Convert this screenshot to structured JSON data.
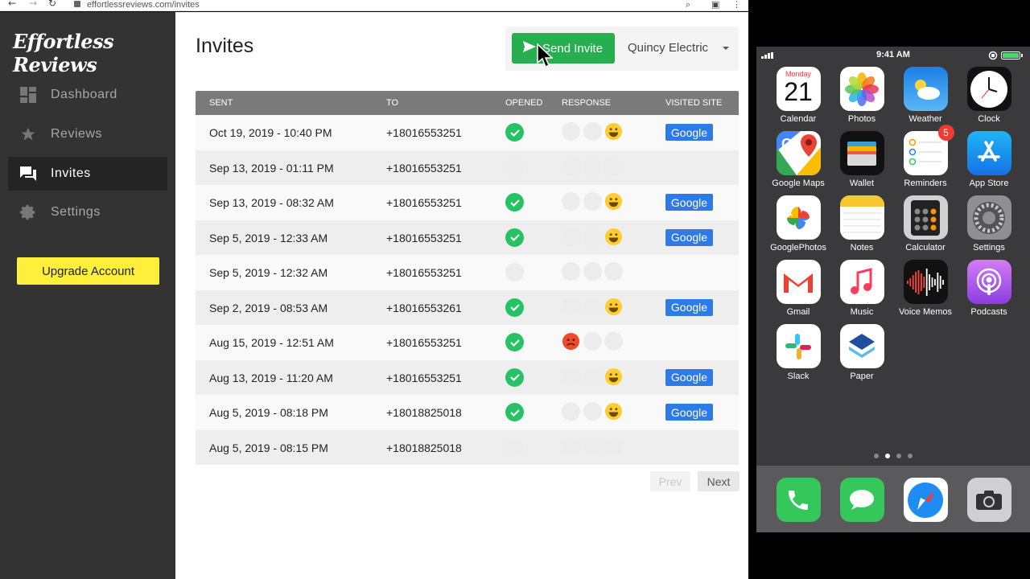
{
  "browser": {
    "url": "effortlessreviews.com/invites"
  },
  "sidebar": {
    "logo": "Effortless Reviews",
    "items": [
      {
        "label": "Dashboard",
        "icon": "dashboard-icon"
      },
      {
        "label": "Reviews",
        "icon": "star-icon"
      },
      {
        "label": "Invites",
        "icon": "chat-icon",
        "active": true
      },
      {
        "label": "Settings",
        "icon": "gear-icon"
      }
    ],
    "upgrade_label": "Upgrade Account"
  },
  "main": {
    "title": "Invites",
    "send_label": "Send Invite",
    "company": "Quincy Electric",
    "columns": [
      "SENT",
      "TO",
      "OPENED",
      "RESPONSE",
      "VISITED SITE"
    ],
    "rows": [
      {
        "sent": "Oct 19, 2019 - 10:40 PM",
        "to": "+18016553251",
        "opened": true,
        "response": "happy",
        "visited": "Google"
      },
      {
        "sent": "Sep 13, 2019 - 01:11 PM",
        "to": "+18016553251",
        "opened": false,
        "response": "none",
        "visited": ""
      },
      {
        "sent": "Sep 13, 2019 - 08:32 AM",
        "to": "+18016553251",
        "opened": true,
        "response": "happy",
        "visited": "Google"
      },
      {
        "sent": "Sep 5, 2019 - 12:33 AM",
        "to": "+18016553251",
        "opened": true,
        "response": "happy",
        "visited": "Google"
      },
      {
        "sent": "Sep 5, 2019 - 12:32 AM",
        "to": "+18016553251",
        "opened": false,
        "response": "none",
        "visited": ""
      },
      {
        "sent": "Sep 2, 2019 - 08:53 AM",
        "to": "+18016553261",
        "opened": true,
        "response": "happy",
        "visited": "Google"
      },
      {
        "sent": "Aug 15, 2019 - 12:51 AM",
        "to": "+18016553251",
        "opened": true,
        "response": "sad",
        "visited": ""
      },
      {
        "sent": "Aug 13, 2019 - 11:20 AM",
        "to": "+18016553251",
        "opened": true,
        "response": "happy",
        "visited": "Google"
      },
      {
        "sent": "Aug 5, 2019 - 08:18 PM",
        "to": "+18018825018",
        "opened": true,
        "response": "happy",
        "visited": "Google"
      },
      {
        "sent": "Aug 5, 2019 - 08:15 PM",
        "to": "+18018825018",
        "opened": false,
        "response": "none",
        "visited": ""
      }
    ],
    "prev_label": "Prev",
    "next_label": "Next"
  },
  "phone": {
    "time": "9:41 AM",
    "calendar_day": "Monday",
    "calendar_date": "21",
    "reminders_badge": "5",
    "apps": [
      {
        "label": "Calendar",
        "icon": "calendar-icon"
      },
      {
        "label": "Photos",
        "icon": "photos-icon"
      },
      {
        "label": "Weather",
        "icon": "weather-icon"
      },
      {
        "label": "Clock",
        "icon": "clock-icon"
      },
      {
        "label": "Google Maps",
        "icon": "google-maps-icon"
      },
      {
        "label": "Wallet",
        "icon": "wallet-icon"
      },
      {
        "label": "Reminders",
        "icon": "reminders-icon"
      },
      {
        "label": "App Store",
        "icon": "app-store-icon"
      },
      {
        "label": "GooglePhotos",
        "icon": "google-photos-icon"
      },
      {
        "label": "Notes",
        "icon": "notes-icon"
      },
      {
        "label": "Calculator",
        "icon": "calculator-icon"
      },
      {
        "label": "Settings",
        "icon": "settings-icon"
      },
      {
        "label": "Gmail",
        "icon": "gmail-icon"
      },
      {
        "label": "Music",
        "icon": "music-icon"
      },
      {
        "label": "Voice Memos",
        "icon": "voice-memos-icon"
      },
      {
        "label": "Podcasts",
        "icon": "podcasts-icon"
      },
      {
        "label": "Slack",
        "icon": "slack-icon"
      },
      {
        "label": "Paper",
        "icon": "paper-icon"
      }
    ],
    "dock": [
      "phone-icon",
      "messages-icon",
      "safari-icon",
      "camera-icon"
    ]
  },
  "colors": {
    "sidebar": "#333333",
    "send": "#27ae4f",
    "google": "#2e7ae6",
    "upgrade": "#ffef3a",
    "check": "#27c265"
  }
}
